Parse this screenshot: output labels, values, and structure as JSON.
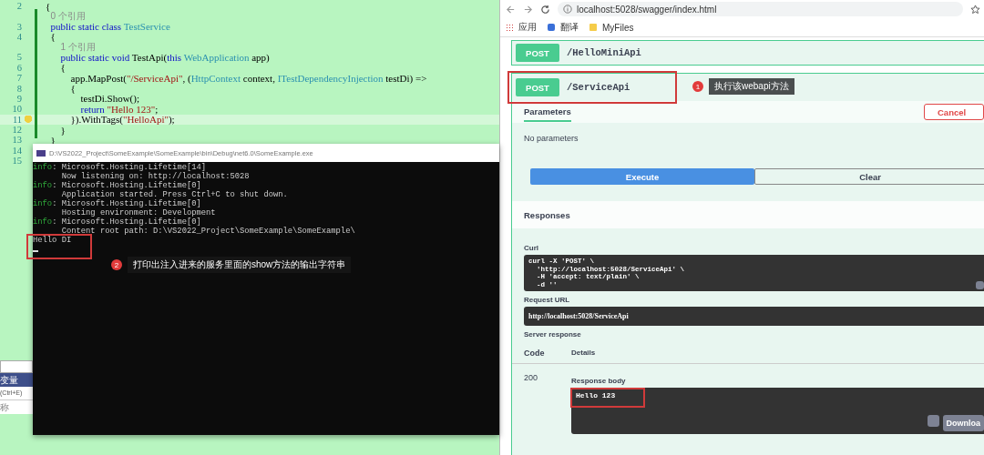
{
  "editor": {
    "lines": [
      {
        "number": "2",
        "current": false,
        "tokens": [
          {
            "t": "{",
            "kind": "plain"
          }
        ]
      },
      {
        "number": "3",
        "current": false,
        "lens": "0 个引用",
        "tokens": [
          {
            "t": "  public static class ",
            "kind": "kw"
          },
          {
            "t": "TestService",
            "kind": "type"
          }
        ]
      },
      {
        "number": "4",
        "current": false,
        "tokens": [
          {
            "t": "  {",
            "kind": "plain"
          }
        ]
      },
      {
        "number": "5",
        "current": false,
        "lens": "1 个引用",
        "tokens": [
          {
            "t": "      public static void ",
            "kind": "kw"
          },
          {
            "t": "TestApi(",
            "kind": "plain"
          },
          {
            "t": "this ",
            "kind": "kw"
          },
          {
            "t": "WebApplication",
            "kind": "type"
          },
          {
            "t": " app)",
            "kind": "plain"
          }
        ]
      },
      {
        "number": "6",
        "current": false,
        "tokens": [
          {
            "t": "      {",
            "kind": "plain"
          }
        ]
      },
      {
        "number": "7",
        "current": false,
        "tokens": [
          {
            "t": "          app.MapPost(",
            "kind": "plain"
          },
          {
            "t": "\"/ServiceApi\"",
            "kind": "str"
          },
          {
            "t": ", (",
            "kind": "plain"
          },
          {
            "t": "HttpContext",
            "kind": "type"
          },
          {
            "t": " context, ",
            "kind": "plain"
          },
          {
            "t": "ITestDependencyInjection",
            "kind": "type"
          },
          {
            "t": " testDi) =>",
            "kind": "plain"
          }
        ]
      },
      {
        "number": "8",
        "current": false,
        "tokens": [
          {
            "t": "          {",
            "kind": "plain"
          }
        ]
      },
      {
        "number": "9",
        "current": false,
        "tokens": [
          {
            "t": "              testDi.Show();",
            "kind": "plain"
          }
        ]
      },
      {
        "number": "10",
        "current": false,
        "tokens": [
          {
            "t": "              return ",
            "kind": "kw"
          },
          {
            "t": "\"Hello 123\"",
            "kind": "str"
          },
          {
            "t": ";",
            "kind": "plain"
          }
        ]
      },
      {
        "number": "11",
        "current": true,
        "tokens": [
          {
            "t": "          }).WithTags(",
            "kind": "plain"
          },
          {
            "t": "\"HelloApi\"",
            "kind": "str"
          },
          {
            "t": ");",
            "kind": "plain"
          }
        ]
      },
      {
        "number": "12",
        "current": false,
        "tokens": [
          {
            "t": "      }",
            "kind": "plain"
          }
        ]
      },
      {
        "number": "13",
        "current": false,
        "tokens": [
          {
            "t": "  }",
            "kind": "plain"
          }
        ]
      },
      {
        "number": "14",
        "current": false
      },
      {
        "number": "15",
        "current": false
      }
    ]
  },
  "side_panel": {
    "header": "变量",
    "hint": "(Ctrl+E)",
    "column": "称"
  },
  "console": {
    "title": "D:\\VS2022_Project\\SomeExample\\SomeExample\\bin\\Debug\\net6.0\\SomeExample.exe",
    "lines": [
      {
        "prefix": "info",
        "text": ": Microsoft.Hosting.Lifetime[14]"
      },
      {
        "text": "      Now listening on: http://localhost:5028"
      },
      {
        "prefix": "info",
        "text": ": Microsoft.Hosting.Lifetime[0]"
      },
      {
        "text": "      Application started. Press Ctrl+C to shut down."
      },
      {
        "prefix": "info",
        "text": ": Microsoft.Hosting.Lifetime[0]"
      },
      {
        "text": "      Hosting environment: Development"
      },
      {
        "prefix": "info",
        "text": ": Microsoft.Hosting.Lifetime[0]"
      },
      {
        "text": "      Content root path: D:\\VS2022_Project\\SomeExample\\SomeExample\\"
      },
      {
        "text": "Hello DI"
      }
    ]
  },
  "callouts": [
    {
      "number": "1",
      "text": "执行该webapi方法"
    },
    {
      "number": "2",
      "text": "打印出注入进来的服务里面的show方法的输出字符串"
    }
  ],
  "browser": {
    "url": "localhost:5028/swagger/index.html",
    "bookmarks": [
      "应用",
      "翻译",
      "MyFiles"
    ]
  },
  "operations": [
    {
      "method": "POST",
      "path": "/HelloMiniApi"
    },
    {
      "method": "POST",
      "path": "/ServiceApi"
    }
  ],
  "details": {
    "tab": "Parameters",
    "cancel": "Cancel",
    "no_params": "No parameters",
    "execute": "Execute",
    "clear": "Clear",
    "responses": "Responses",
    "curl_label": "Curl",
    "curl": [
      "curl -X 'POST' \\",
      "  'http://localhost:5028/ServiceApi' \\",
      "  -H 'accept: text/plain' \\",
      "  -d ''"
    ],
    "request_url_label": "Request URL",
    "request_url": "http://localhost:5028/ServiceApi",
    "server_response": "Server response",
    "code_header": "Code",
    "details_header": "Details",
    "code": "200",
    "response_body_label": "Response body",
    "response_body": "Hello 123",
    "download": "Downloa"
  }
}
